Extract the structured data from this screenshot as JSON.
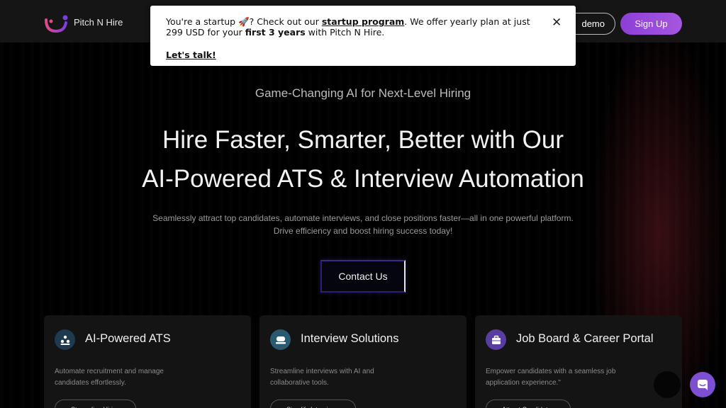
{
  "header": {
    "brand_name": "Pitch N Hire",
    "demo_label": "demo",
    "signup_label": "Sign Up"
  },
  "banner": {
    "text_prefix": "You're a startup 🚀? Check out our ",
    "program_link": "startup program",
    "text_middle": ". We offer yearly plan at just 299 USD for your ",
    "years_bold": "first 3 years",
    "text_suffix": " with Pitch N Hire.",
    "cta": "Let's talk!",
    "close_glyph": "✕"
  },
  "hero": {
    "tagline": "Game-Changing AI for Next-Level Hiring",
    "title_line1": "Hire Faster, Smarter, Better with Our",
    "title_line2": "AI-Powered ATS & Interview Automation",
    "subtitle_line1": "Seamlessly attract top candidates, automate interviews, and close positions faster—all in one powerful platform.",
    "subtitle_line2": "Drive efficiency and boost hiring success today!",
    "contact_label": "Contact Us"
  },
  "cards": [
    {
      "title": "AI-Powered ATS",
      "description": "Automate recruitment and manage candidates effortlessly.",
      "button": "Streamline Hiring",
      "icon": "people-icon",
      "icon_bg": "#1d3a4e"
    },
    {
      "title": "Interview Solutions",
      "description": "Streamline interviews with AI and collaborative tools.",
      "button": "Simplify Interviews",
      "icon": "chat-bubble-icon",
      "icon_bg": "#2a5a72"
    },
    {
      "title": "Job Board & Career Portal",
      "description": "Empower candidates with a seamless job application experience.\"",
      "button": "Attract Candidates",
      "icon": "briefcase-icon",
      "icon_bg": "#5a3da0"
    }
  ],
  "colors": {
    "accent_purple": "#8c3fd6",
    "chat_launcher": "#7d4fd1"
  }
}
